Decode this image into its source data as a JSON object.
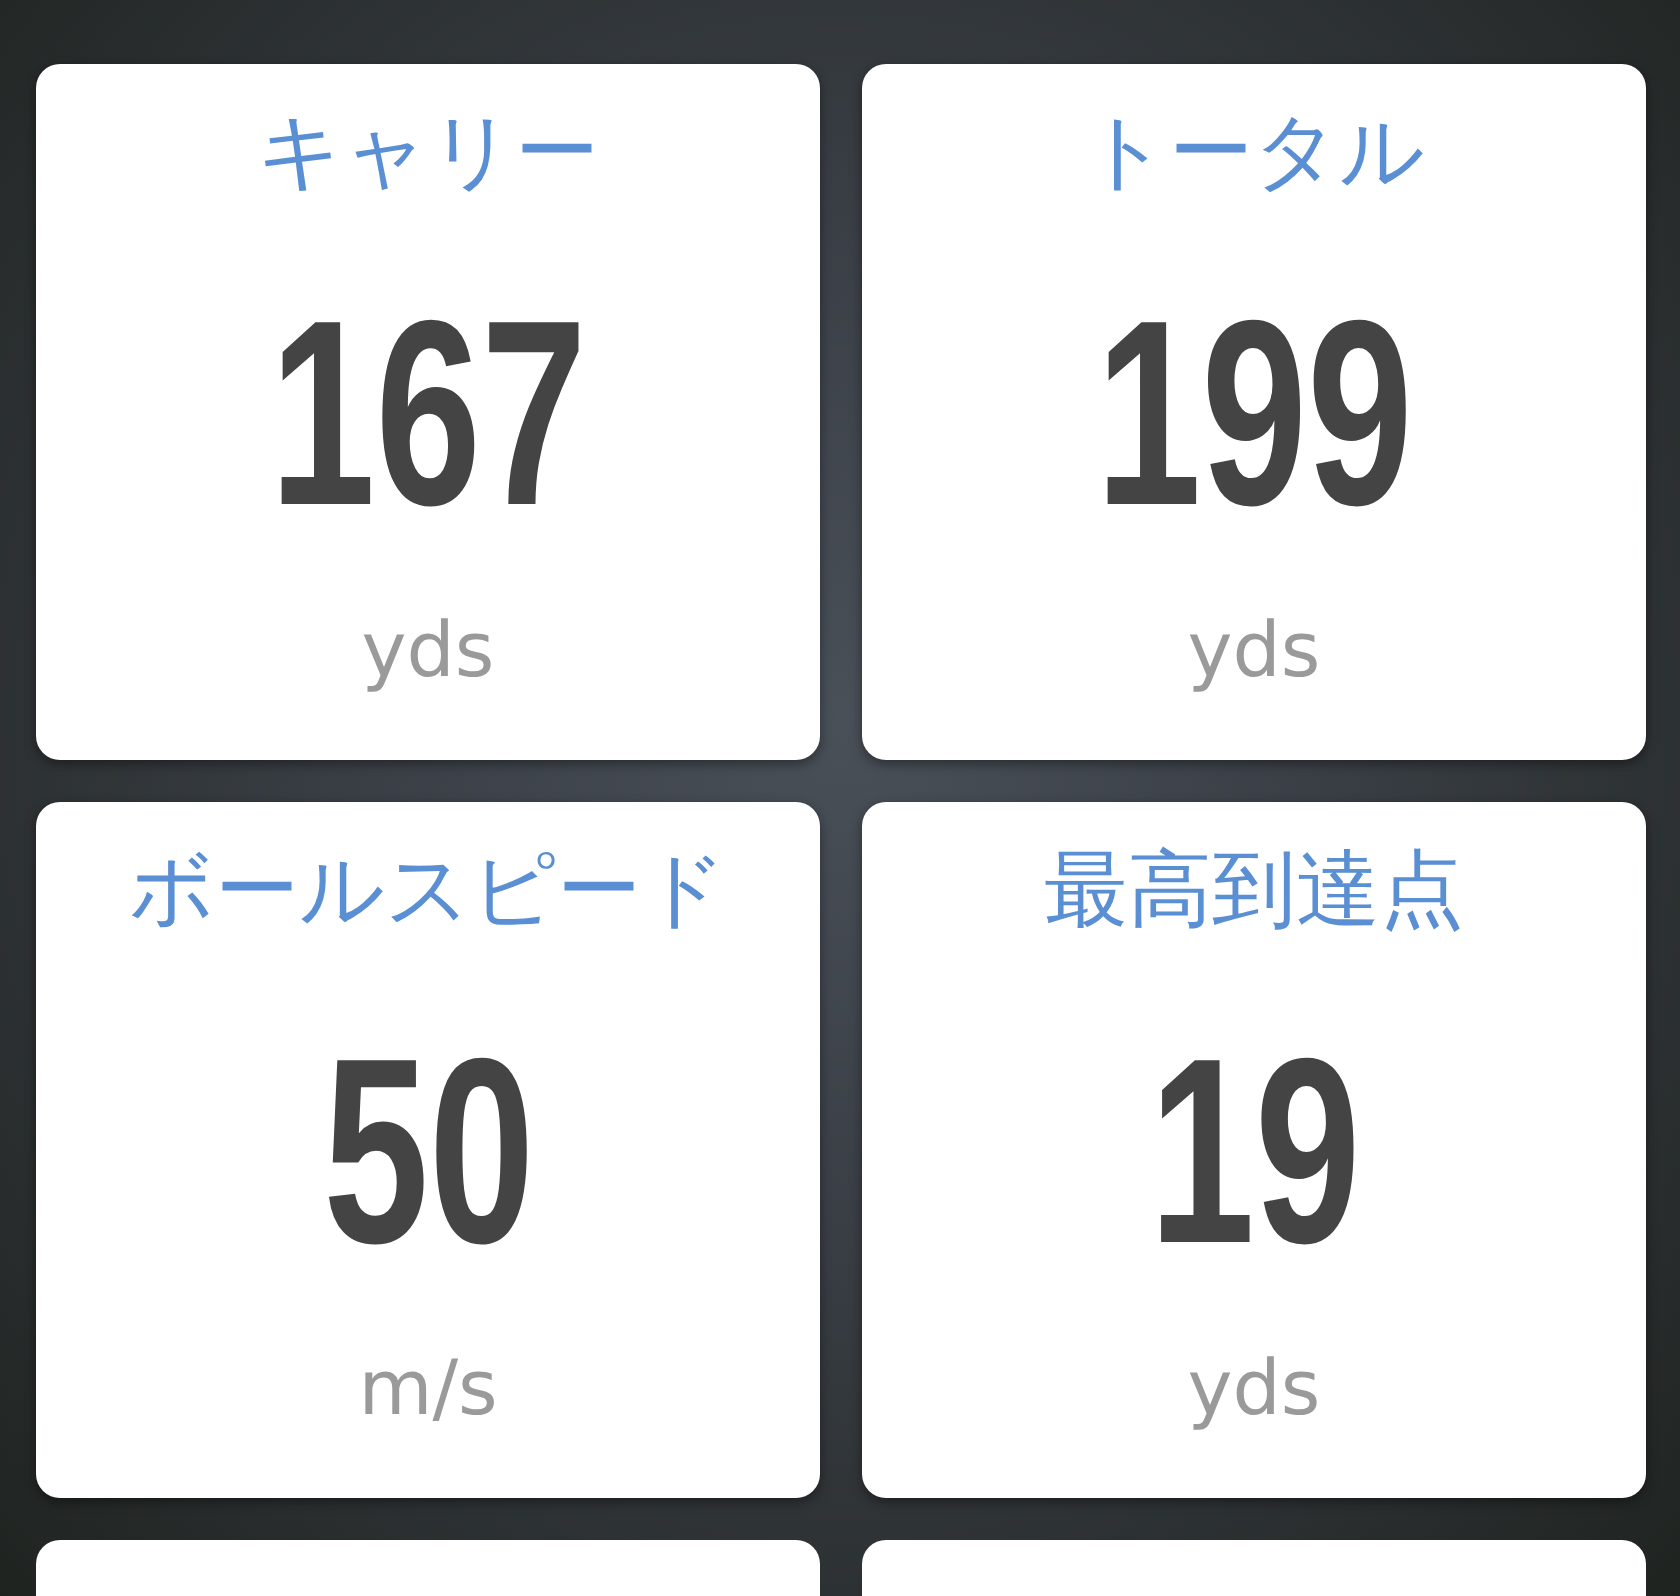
{
  "metrics": [
    {
      "label": "キャリー",
      "value": "167",
      "unit": "yds"
    },
    {
      "label": "トータル",
      "value": "199",
      "unit": "yds"
    },
    {
      "label": "ボールスピード",
      "value": "50",
      "unit": "m/s"
    },
    {
      "label": "最高到達点",
      "value": "19",
      "unit": "yds"
    }
  ],
  "partial_cards": [
    {
      "kind": "cut_off"
    },
    {
      "kind": "cut_off"
    }
  ]
}
